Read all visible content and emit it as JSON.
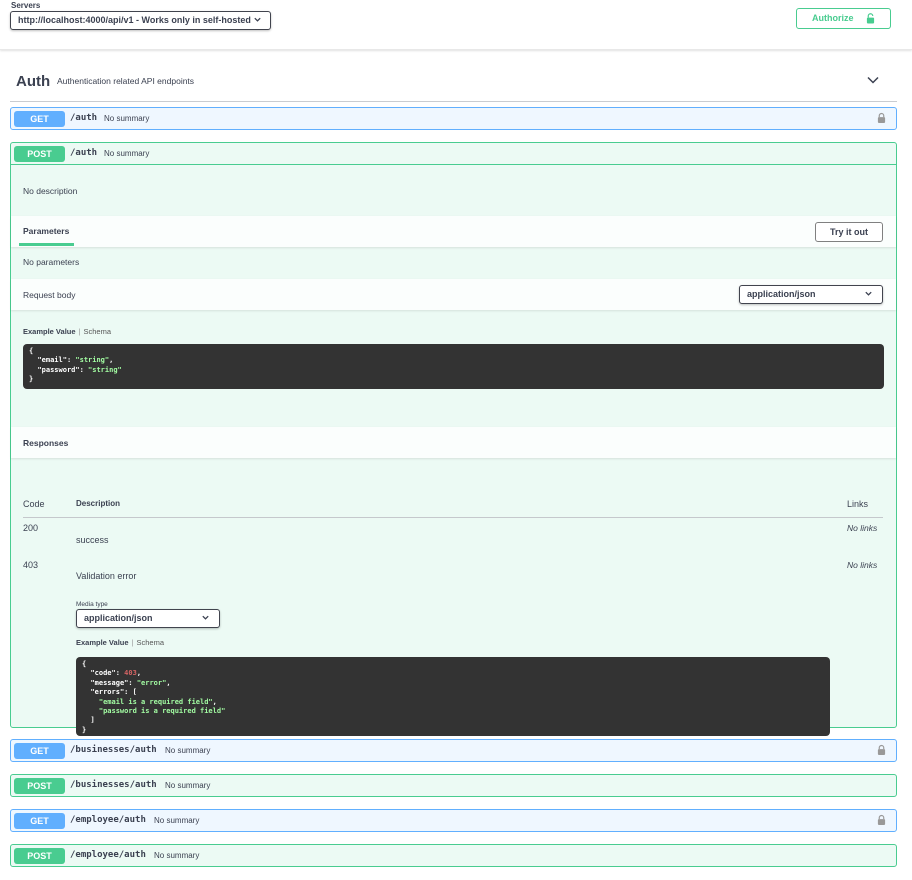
{
  "servers": {
    "label": "Servers",
    "selected": "http://localhost:4000/api/v1 - Works only in self-hosted"
  },
  "authorize": {
    "label": "Authorize"
  },
  "tag": {
    "name": "Auth",
    "description": "Authentication related API endpoints"
  },
  "operations": [
    {
      "method": "GET",
      "path": "/auth",
      "summary": "No summary"
    },
    {
      "method": "POST",
      "path": "/auth",
      "summary": "No summary"
    },
    {
      "method": "GET",
      "path": "/businesses/auth",
      "summary": "No summary"
    },
    {
      "method": "POST",
      "path": "/businesses/auth",
      "summary": "No summary"
    },
    {
      "method": "GET",
      "path": "/employee/auth",
      "summary": "No summary"
    },
    {
      "method": "POST",
      "path": "/employee/auth",
      "summary": "No summary"
    }
  ],
  "post_auth": {
    "description": "No description",
    "parameters_tab": "Parameters",
    "try_it_out": "Try it out",
    "no_parameters": "No parameters",
    "request_body_label": "Request body",
    "request_content_type": "application/json",
    "example_value_tab": "Example Value",
    "schema_tab": "Schema",
    "request_example": {
      "open": "{",
      "email_key": "\"email\"",
      "email_val": "\"string\"",
      "password_key": "\"password\"",
      "password_val": "\"string\"",
      "close": "}"
    },
    "responses_title": "Responses",
    "columns": {
      "code": "Code",
      "description": "Description",
      "links": "Links"
    },
    "responses": [
      {
        "code": "200",
        "description": "success",
        "links": "No links"
      },
      {
        "code": "403",
        "description": "Validation error",
        "links": "No links"
      }
    ],
    "media_type_label": "Media type",
    "response_content_type": "application/json",
    "response_example": {
      "open": "{",
      "code_key": "\"code\"",
      "code_val": "403",
      "message_key": "\"message\"",
      "message_val": "\"error\"",
      "errors_key": "\"errors\"",
      "err1": "\"email is a required field\"",
      "err2": "\"password is a required field\"",
      "arr_close": "]",
      "close": "}"
    }
  },
  "colors": {
    "get": "#61affe",
    "post": "#49cc90",
    "code_bg": "#333333",
    "string": "#a2fca2",
    "number": "#d36363"
  },
  "icons": [
    "chevron-down-icon",
    "lock-icon",
    "unlock-icon"
  ]
}
